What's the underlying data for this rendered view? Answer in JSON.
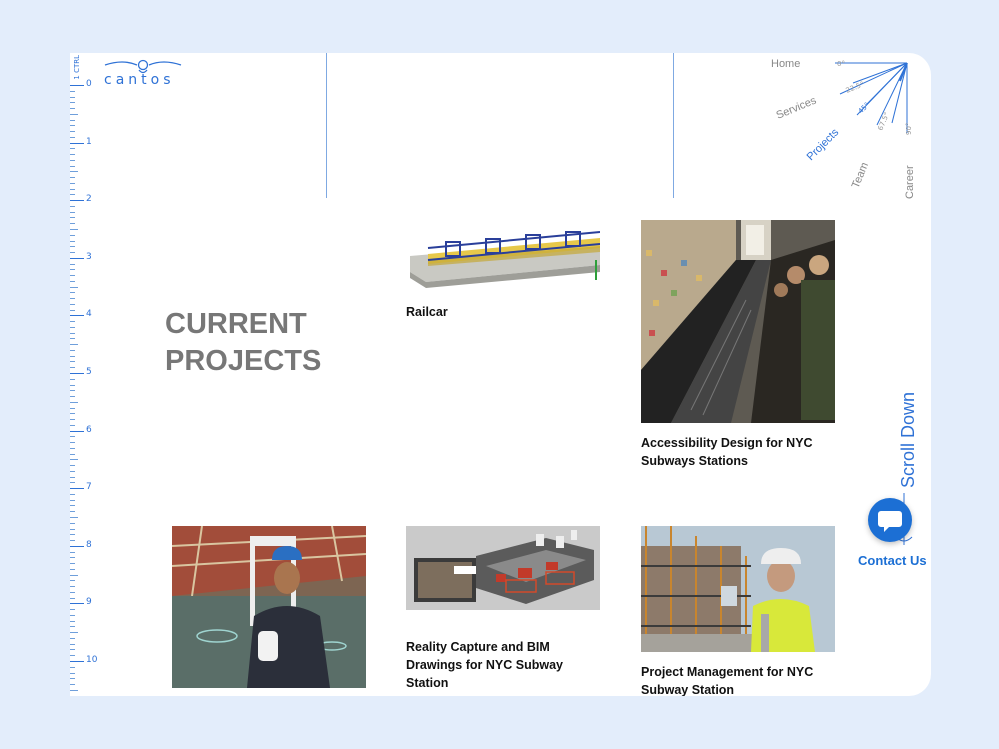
{
  "brand": {
    "logo_text": "cantos"
  },
  "ruler": {
    "top_label": "1 CTRL",
    "numbers": [
      "0",
      "1",
      "2",
      "3",
      "4",
      "5",
      "6",
      "7",
      "8",
      "9",
      "10"
    ]
  },
  "nav": {
    "items": [
      {
        "label": "Home",
        "angle": "0°",
        "active": false
      },
      {
        "label": "Services",
        "angle": "22.5°",
        "active": false
      },
      {
        "label": "Projects",
        "angle": "45°",
        "active": true
      },
      {
        "label": "Team",
        "angle": "67.5°",
        "active": false
      },
      {
        "label": "Career",
        "angle": "90°",
        "active": false
      }
    ]
  },
  "main": {
    "heading_line1": "CURRENT",
    "heading_line2": "PROJECTS",
    "projects": [
      {
        "title": "Railcar"
      },
      {
        "title": "Accessibility Design for NYC Subways Stations"
      },
      {
        "title": ""
      },
      {
        "title": "Reality Capture and BIM Drawings for NYC Subway Station"
      },
      {
        "title": "Project Management for NYC Subway Station"
      }
    ]
  },
  "scroll_label": "Scroll Down",
  "contact_label": "Contact Us",
  "colors": {
    "accent": "#2f72d6",
    "contact": "#1c6fd4",
    "heading": "#777777"
  }
}
